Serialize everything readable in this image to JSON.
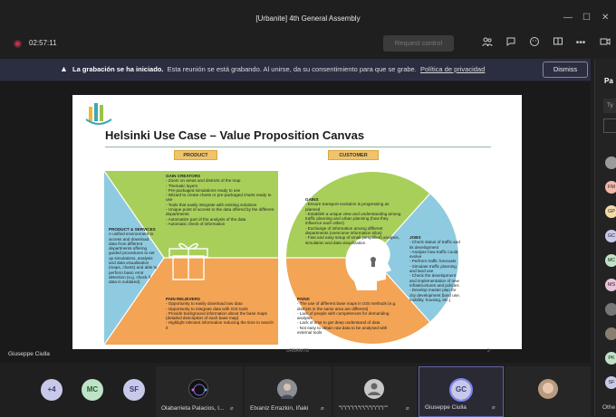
{
  "window": {
    "title": "[Urbanite] 4th General Assembly"
  },
  "toolbar": {
    "timer": "02:57:11",
    "request_control": "Request control"
  },
  "banner": {
    "headline": "La grabación se ha iniciado.",
    "message": "Esta reunión se está grabando. Al unirse, da su consentimiento para que se grabe.",
    "link": "Política de privacidad",
    "dismiss": "Dismiss"
  },
  "side_panel": {
    "title": "Pa",
    "search_placeholder": "Ty",
    "avatars": [
      "",
      "FM",
      "GP",
      "GC",
      "MC",
      "MS",
      "",
      "",
      "PK",
      "SF"
    ],
    "other_label": "Othe"
  },
  "slide": {
    "title": "Helsinki Use Case – Value Proposition Canvas",
    "product_tag": "PRODUCT",
    "customer_tag": "CUSTOMER",
    "footer": "URBANITE",
    "page": "2",
    "gain_creators": {
      "heading": "GAIN CREATORS",
      "items": [
        "- Zoom on areas and districts of the map",
        "- Thematic layers",
        "- Pre-packaged simulations ready to use",
        "- Wizard to create charts or pre-packaged charts ready to use",
        "- Tools that easily integrate with existing solutions",
        "- Unique point of access to the data offered by the different departments",
        "- Automatize part of the analysis of the data",
        "- Automatic check of information"
      ]
    },
    "products": {
      "heading": "PRODUCT & SERVICES",
      "body": "A unified environment to access and download data from different departments offering guided procedures to set up simulations, analysis and data visualisation (maps, charts) and able to perform basic error detection (e.g. check if data is outdated)."
    },
    "pain_relievers": {
      "heading": "PAIN RELIEVERS",
      "items": [
        "- Opportunity to easily download raw data",
        "- Opportunity to integrate data with GIS tools",
        "- Provide background information about the base maps (detailed description of each base map)",
        "- Highlight relevant information reducing the time to search it"
      ]
    },
    "gains": {
      "heading": "GAINS",
      "items": [
        "- Ensure transport evolution is progressing as planned",
        "- Establish a unique view and understanding among traffic planning and urban planning (how they influence each other)",
        "- Exchange of information among different departments (overcome information silos)",
        "- Fast and easy setup of small (simplified) analysis, simulation and data visualization"
      ]
    },
    "jobs": {
      "heading": "JOBS",
      "items": [
        "- Check status of traffic and its development",
        "- Analyse how traffic could evolve",
        "- Perform traffic forecasts",
        "- Simulate traffic planning and land use",
        "- Check the development and implementation of new infrastructures and policies",
        "- Develop master plan for city development (land use, mobility, housing, etc.)"
      ]
    },
    "pains": {
      "heading": "PAINS",
      "items": [
        "- The use of different base maps in GIS methods (e.g. districts in the same area are different)",
        "- Lack of people with competences for demanding analysis",
        "- Lack of time to get deep understand of data",
        "- Not easy to obtain raw data to be analysed with external tools"
      ]
    }
  },
  "presenter": {
    "name": "Giuseppe Ciulla"
  },
  "participants": {
    "overflow": "+4",
    "pills": [
      "MC",
      "SF"
    ],
    "tiles": [
      {
        "name": "Olabarrieta Palacios, I..."
      },
      {
        "name": "Etxaniz Errazkin, Iñaki"
      },
      {
        "name": "\"\\\"\\\"\\\"\\\"\\\"\\\"\\\"\\\"\\\"\\\"\\\"\\\"\""
      },
      {
        "name": "Giuseppe Ciulla",
        "initials": "GC"
      },
      {
        "name": ""
      }
    ]
  },
  "colors": {
    "green": "#a9cf5b",
    "orange": "#f3a455",
    "blue": "#8ecbe0",
    "banner": "#2b2d41",
    "accent": "#6264a7"
  }
}
